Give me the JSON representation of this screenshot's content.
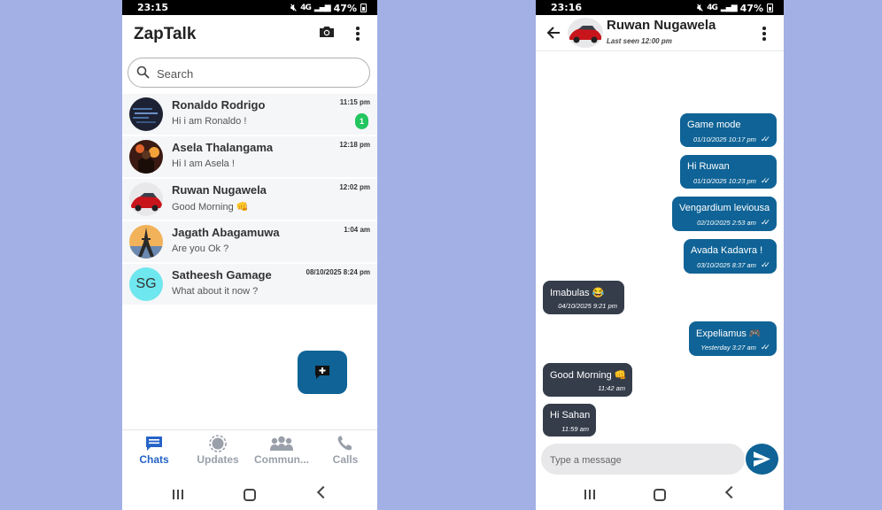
{
  "status_left": {
    "time": "23:15",
    "battery": "47%",
    "network": "4G"
  },
  "status_right": {
    "time": "23:16",
    "battery": "47%",
    "network": "4G"
  },
  "chats_screen": {
    "app_title": "ZapTalk",
    "search_placeholder": "Search",
    "chats": [
      {
        "name": "Ronaldo Rodrigo",
        "message": "Hi i am Ronaldo !",
        "time": "11:15 pm",
        "unread": "1"
      },
      {
        "name": "Asela Thalangama",
        "message": "Hi I am Asela !",
        "time": "12:18 pm"
      },
      {
        "name": "Ruwan Nugawela",
        "message": "Good Morning 👊",
        "time": "12:02 pm"
      },
      {
        "name": "Jagath Abagamuwa",
        "message": "Are you Ok ?",
        "time": "1:04 am"
      },
      {
        "name": "Satheesh Gamage",
        "message": "What about it now ?",
        "time": "08/10/2025 8:24 pm",
        "initials": "SG"
      }
    ],
    "nav": [
      {
        "label": "Chats",
        "icon": "chat-bubble-icon",
        "active": true
      },
      {
        "label": "Updates",
        "icon": "updates-icon"
      },
      {
        "label": "Commun...",
        "icon": "communities-icon"
      },
      {
        "label": "Calls",
        "icon": "phone-icon"
      }
    ],
    "colors": {
      "accent": "#0f6396",
      "active_nav": "#2563c8",
      "unread_badge": "#22c55e"
    }
  },
  "conversation_screen": {
    "contact_name": "Ruwan Nugawela",
    "last_seen": "Last seen 12:00 pm",
    "messages": [
      {
        "direction": "out",
        "text": "Game mode",
        "time": "01/10/2025 10:17 pm",
        "ticks": "✓✓"
      },
      {
        "direction": "out",
        "text": "Hi Ruwan",
        "time": "01/10/2025 10:23 pm",
        "ticks": "✓✓"
      },
      {
        "direction": "out",
        "text": "Vengardium leviousa",
        "time": "02/10/2025 2:53 am",
        "ticks": "✓✓"
      },
      {
        "direction": "out",
        "text": "Avada Kadavra !",
        "time": "03/10/2025 8:37 am",
        "ticks": "✓✓"
      },
      {
        "direction": "in",
        "text": "Imabulas 😂",
        "time": "04/10/2025 9:21 pm"
      },
      {
        "direction": "out",
        "text": "Expeliamus 🎮",
        "time": "Yesterday 3:27 am",
        "ticks": "✓✓"
      },
      {
        "direction": "in",
        "text": "Good Morning 👊",
        "time": "11:42 am"
      },
      {
        "direction": "in",
        "text": "Hi Sahan",
        "time": "11:59 am"
      }
    ],
    "composer_placeholder": "Type a message",
    "colors": {
      "outgoing_bubble": "#0f6396",
      "incoming_bubble": "#353d4b"
    }
  }
}
